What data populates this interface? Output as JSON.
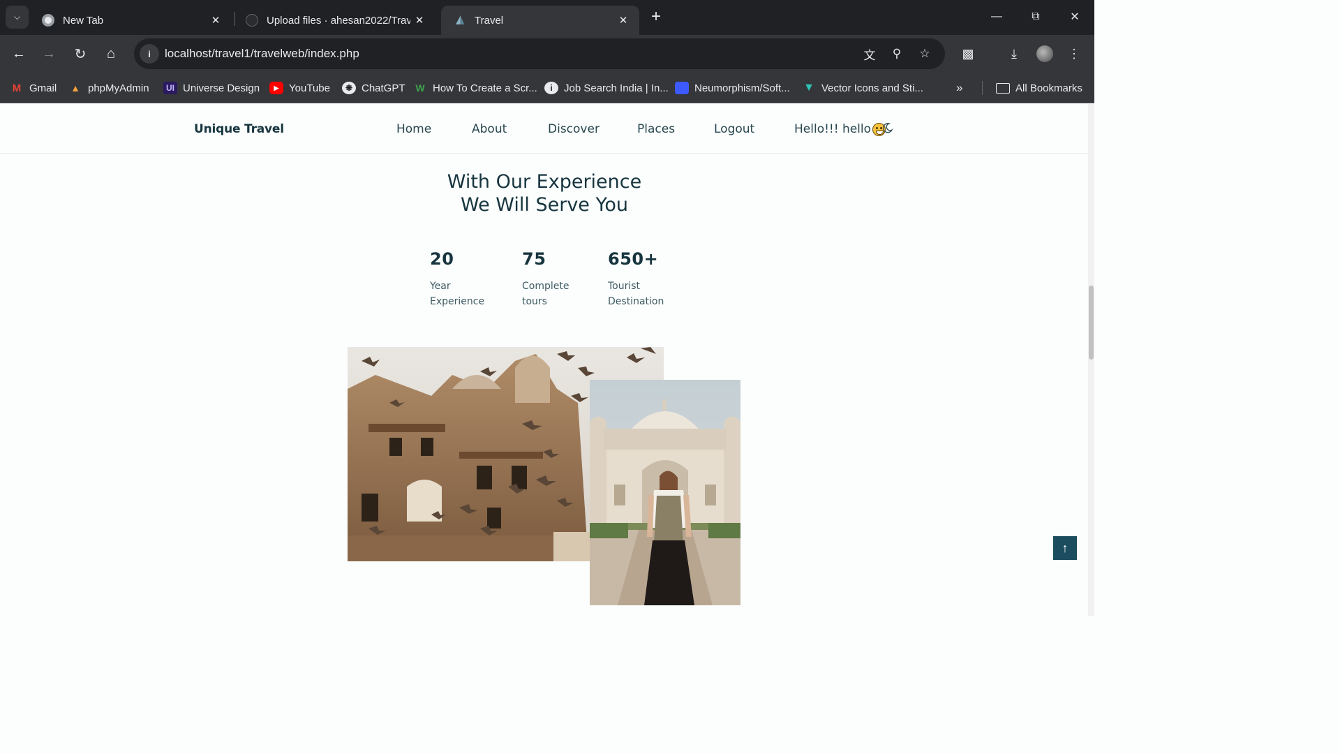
{
  "browser": {
    "tabs": [
      {
        "title": "New Tab",
        "active": false
      },
      {
        "title": "Upload files · ahesan2022/Trave",
        "active": false
      },
      {
        "title": "Travel",
        "active": true
      }
    ],
    "url": "localhost/travel1/travelweb/index.php",
    "bookmarks": [
      {
        "label": "Gmail",
        "icon": "gmail-icon"
      },
      {
        "label": "phpMyAdmin",
        "icon": "phpmyadmin-icon"
      },
      {
        "label": "Universe Design",
        "icon": "ui-icon"
      },
      {
        "label": "YouTube",
        "icon": "youtube-icon"
      },
      {
        "label": "ChatGPT",
        "icon": "chatgpt-icon"
      },
      {
        "label": "How To Create a Scr...",
        "icon": "w-icon"
      },
      {
        "label": "Job Search India | In...",
        "icon": "info-icon"
      },
      {
        "label": "Neumorphism/Soft...",
        "icon": "square-icon"
      },
      {
        "label": "Vector Icons and Sti...",
        "icon": "vector-icon"
      }
    ],
    "all_bookmarks": "All Bookmarks"
  },
  "site": {
    "logo": "Unique Travel",
    "nav": [
      "Home",
      "About",
      "Discover",
      "Places",
      "Logout"
    ],
    "greeting": "Hello!!! hello"
  },
  "section": {
    "title_line1": "With Our Experience",
    "title_line2": "We Will Serve You",
    "stats": [
      {
        "number": "20",
        "label_line1": "Year",
        "label_line2": "Experience"
      },
      {
        "number": "75",
        "label_line1": "Complete",
        "label_line2": "tours"
      },
      {
        "number": "650+",
        "label_line1": "Tourist",
        "label_line2": "Destination"
      }
    ]
  }
}
